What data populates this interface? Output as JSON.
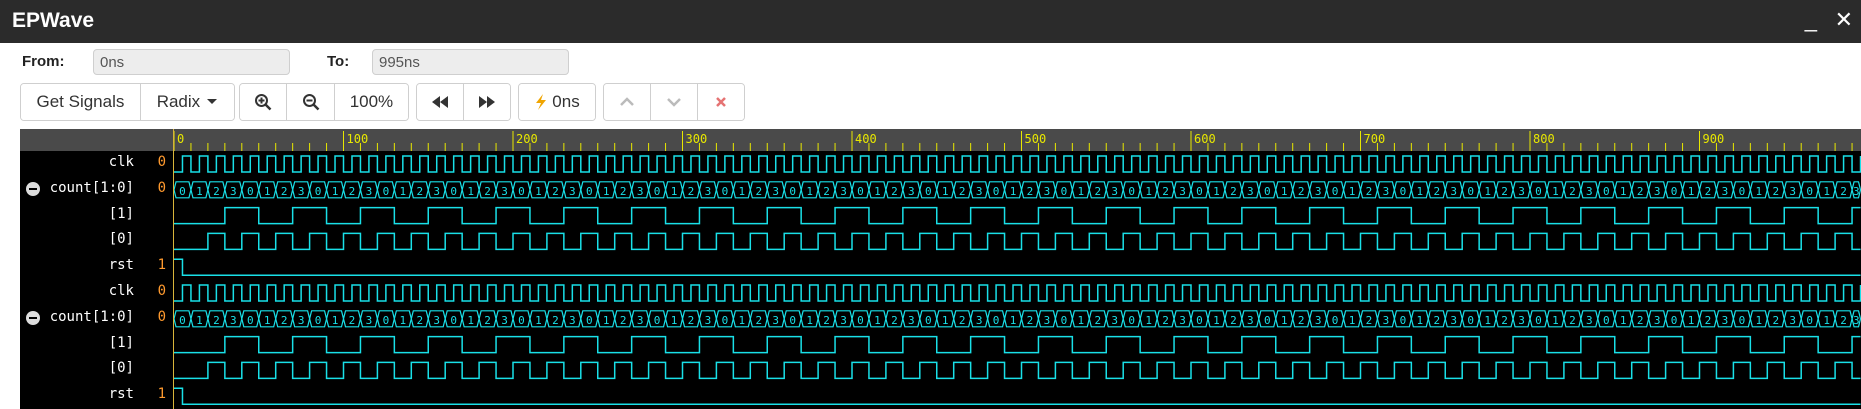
{
  "window": {
    "title": "EPWave",
    "minimize": "_",
    "close": "✕"
  },
  "range": {
    "from_label": "From:",
    "from_value": "0ns",
    "to_label": "To:",
    "to_value": "995ns"
  },
  "toolbar": {
    "get_signals": "Get Signals",
    "radix": "Radix",
    "zoom_in_icon": "zoom-in-icon",
    "zoom_out_icon": "zoom-out-icon",
    "zoom_level": "100%",
    "prev_icon": "rewind-icon",
    "next_icon": "fast-forward-icon",
    "cursor_time": "0ns",
    "cursor_icon": "bolt-icon",
    "up_icon": "chevron-up-icon",
    "down_icon": "chevron-down-icon",
    "clear_icon": "close-icon"
  },
  "ruler": {
    "ticks": [
      "0",
      "100",
      "200",
      "300",
      "400",
      "500",
      "600",
      "700",
      "800",
      "900"
    ]
  },
  "signals": [
    {
      "name": "clk",
      "value": "0",
      "kind": "clock",
      "collapsible": false
    },
    {
      "name": "count[1:0]",
      "value": "0",
      "kind": "bus",
      "collapsible": true
    },
    {
      "name": "[1]",
      "value": "",
      "kind": "bit1",
      "collapsible": false
    },
    {
      "name": "[0]",
      "value": "",
      "kind": "bit0",
      "collapsible": false
    },
    {
      "name": "rst",
      "value": "1",
      "kind": "reset",
      "collapsible": false
    },
    {
      "name": "clk",
      "value": "0",
      "kind": "clock",
      "collapsible": false
    },
    {
      "name": "count[1:0]",
      "value": "0",
      "kind": "bus",
      "collapsible": true
    },
    {
      "name": "[1]",
      "value": "",
      "kind": "bit1",
      "collapsible": false
    },
    {
      "name": "[0]",
      "value": "",
      "kind": "bit0",
      "collapsible": false
    },
    {
      "name": "rst",
      "value": "1",
      "kind": "reset",
      "collapsible": false
    }
  ],
  "bus_values": [
    "0",
    "1",
    "2",
    "3"
  ],
  "colors": {
    "wave": "#19e0e8",
    "wave_highlight": "#4cff4c",
    "value": "#ff9a2e",
    "ruler_text": "#e8e800",
    "ruler_bg": "#4a4a4a"
  }
}
